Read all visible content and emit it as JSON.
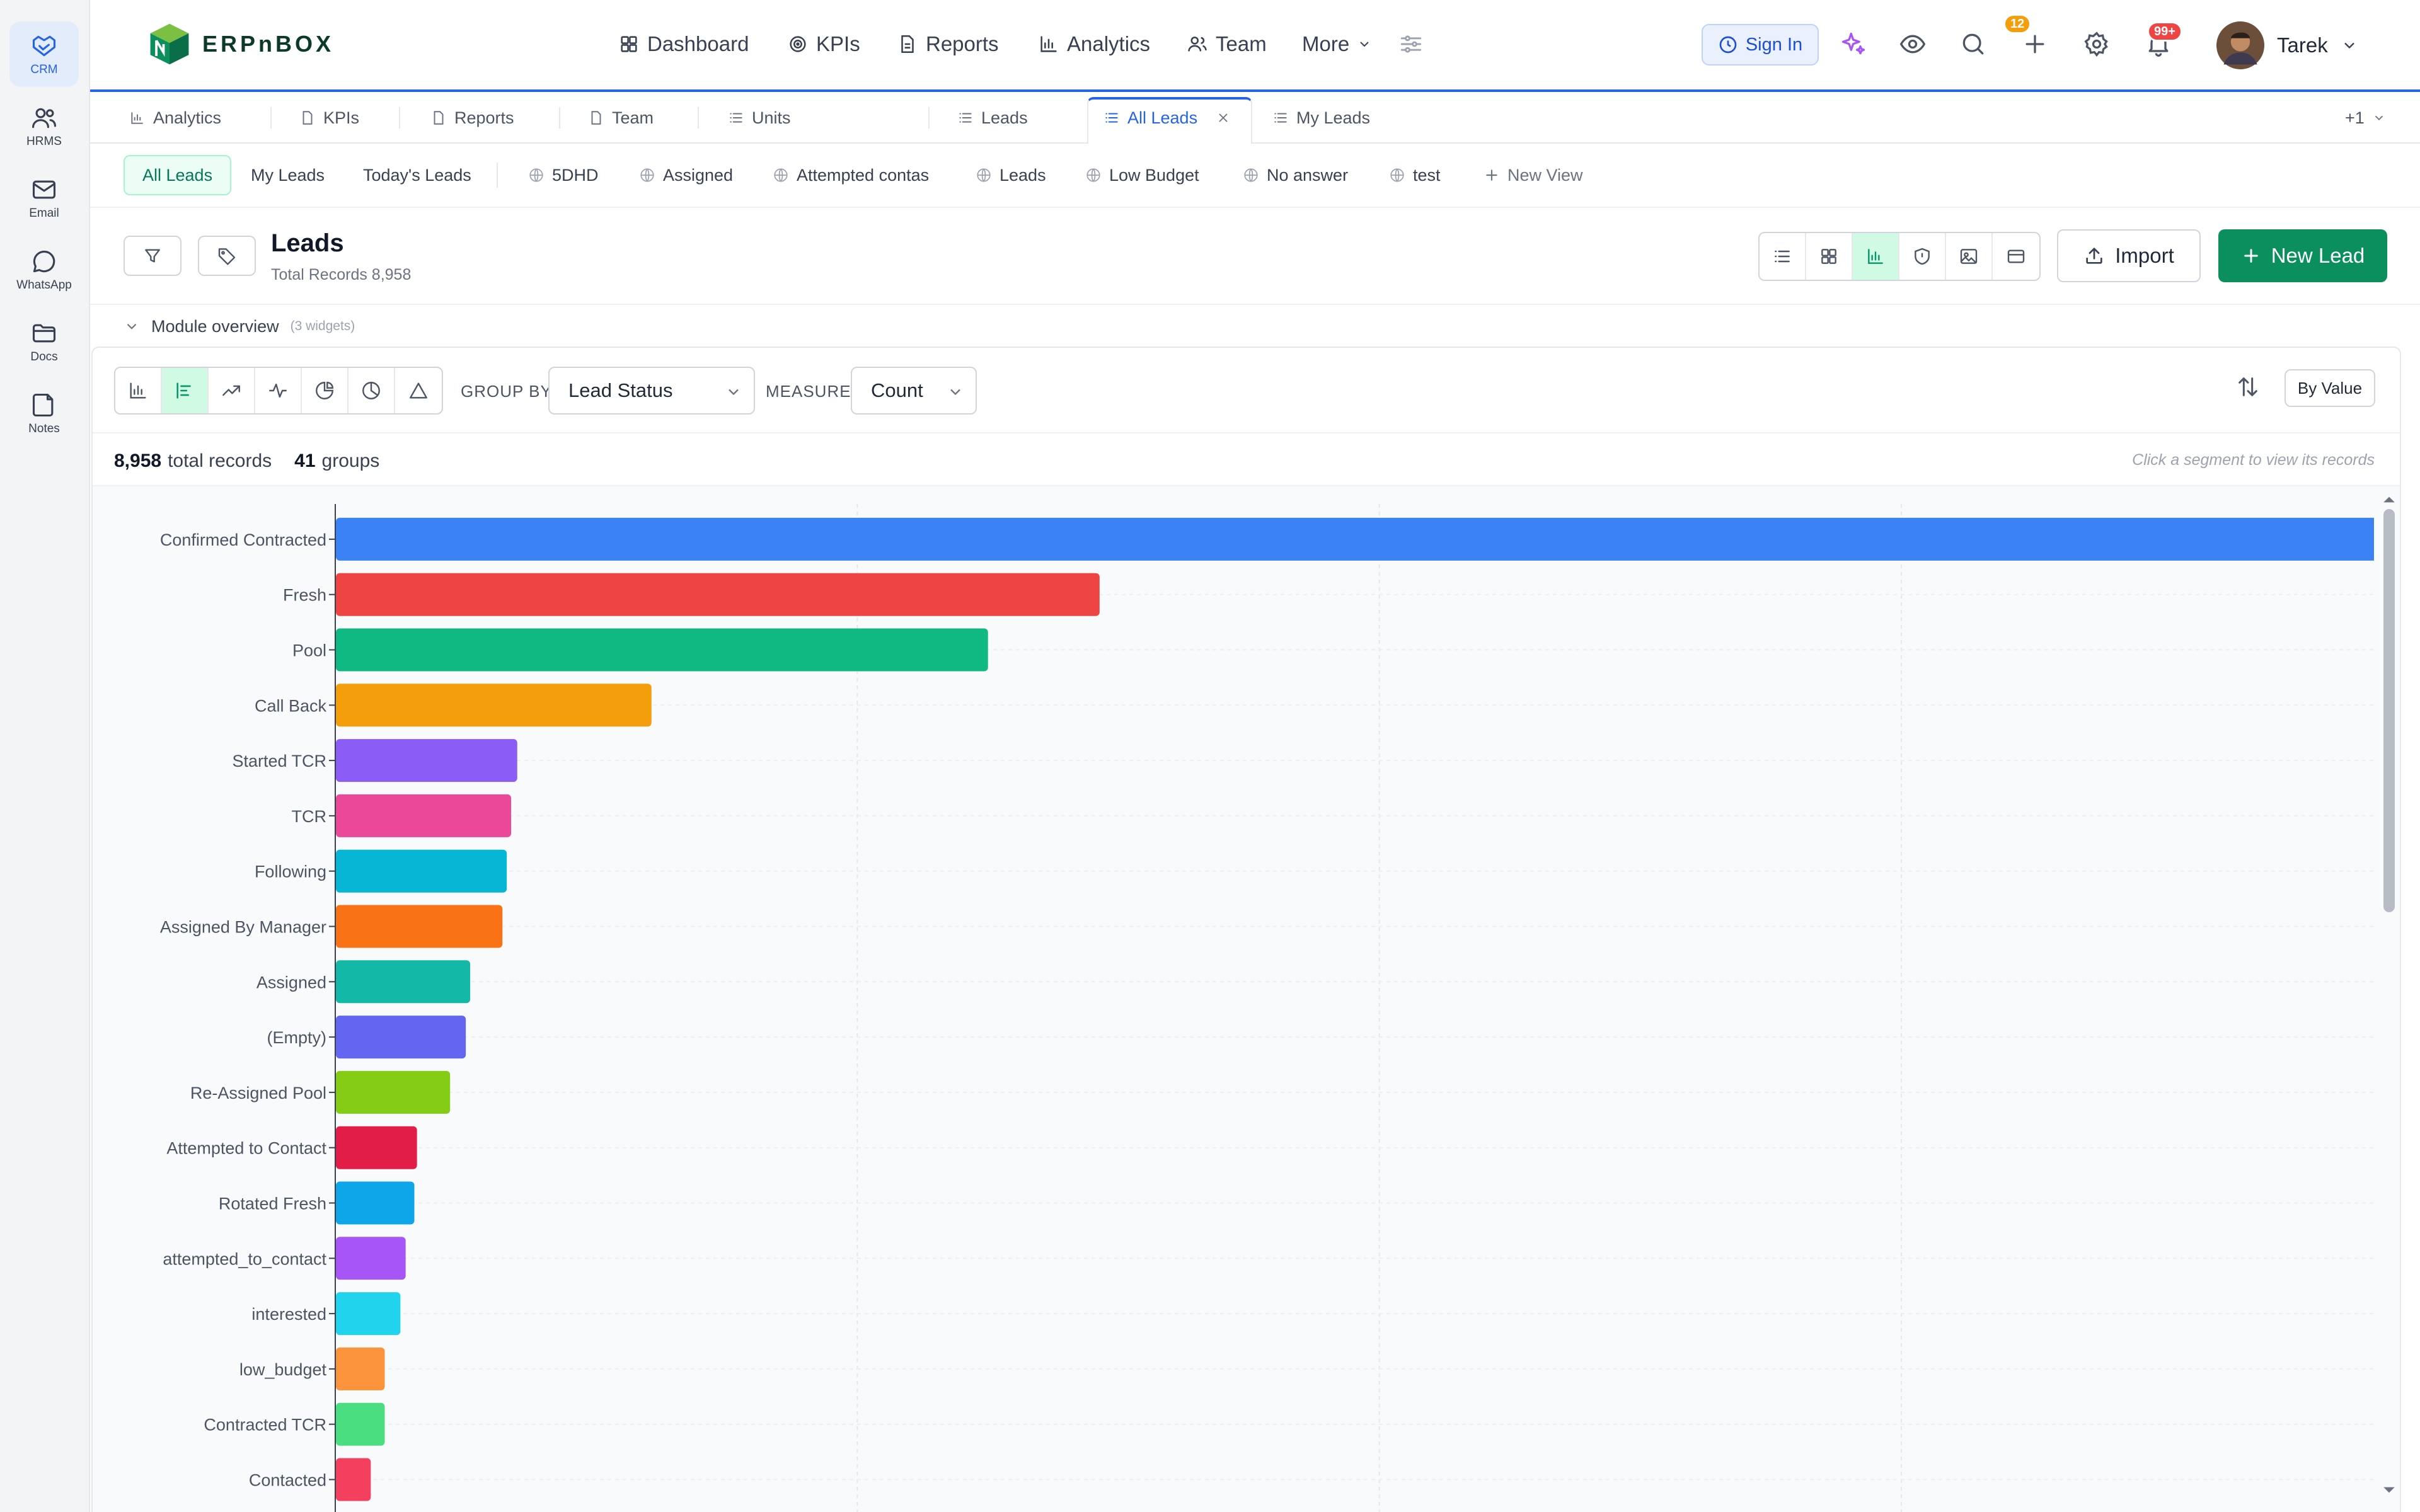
{
  "rail": {
    "items": [
      {
        "label": "CRM",
        "icon": "handshake-icon"
      },
      {
        "label": "HRMS",
        "icon": "users-icon"
      },
      {
        "label": "Email",
        "icon": "mail-icon"
      },
      {
        "label": "WhatsApp",
        "icon": "chat-bubble-icon"
      },
      {
        "label": "Docs",
        "icon": "folder-icon"
      },
      {
        "label": "Notes",
        "icon": "note-icon"
      }
    ]
  },
  "header": {
    "logo_text": "ERPnBOX",
    "nav": [
      "Dashboard",
      "KPIs",
      "Reports",
      "Analytics",
      "Team",
      "More"
    ],
    "sign_in": "Sign In",
    "watch_badge": "12",
    "notif_badge": "99+",
    "user_name": "Tarek"
  },
  "tabs": {
    "items": [
      "Analytics",
      "KPIs",
      "Reports",
      "Team",
      "Units",
      "Leads",
      "All Leads",
      "My Leads"
    ],
    "overflow": "+1"
  },
  "views": {
    "items": [
      "All Leads",
      "My Leads",
      "Today's Leads",
      "5DHD",
      "Assigned",
      "Attempted contas",
      "Leads",
      "Low Budget",
      "No answer",
      "test"
    ],
    "new_view": "New View"
  },
  "page": {
    "title": "Leads",
    "subtitle": "Total Records 8,958",
    "import_label": "Import",
    "new_lead_label": "New Lead"
  },
  "overview": {
    "label": "Module overview",
    "count": "(3 widgets)"
  },
  "chart_controls": {
    "group_by_label": "GROUP BY",
    "group_by_value": "Lead Status",
    "measure_label": "MEASURE",
    "measure_value": "Count",
    "sort_label": "By Value"
  },
  "summary": {
    "total": "8,958",
    "total_suffix": "total records",
    "groups": "41",
    "groups_suffix": "groups",
    "hint": "Click a segment to view its records"
  },
  "colors": {
    "brand_green": "#0b8f5c",
    "accent_blue": "#2563eb",
    "badge_orange": "#f59e0b",
    "badge_red": "#ef4444"
  },
  "chart_data": {
    "type": "bar",
    "orientation": "horizontal",
    "categories": [
      "Confirmed Contracted",
      "Fresh",
      "Pool",
      "Call Back",
      "Started TCR",
      "TCR",
      "Following",
      "Assigned By Manager",
      "Assigned",
      "(Empty)",
      "Re-Assigned Pool",
      "Attempted to Contact",
      "Rotated Fresh",
      "attempted_to_contact",
      "interested",
      "low_budget",
      "Contracted TCR",
      "Contacted"
    ],
    "values": [
      2394,
      876,
      748,
      362,
      208,
      201,
      196,
      191,
      154,
      149,
      131,
      93,
      90,
      80,
      74,
      56,
      56,
      40
    ],
    "colors": [
      "#3b82f6",
      "#ef4444",
      "#10b981",
      "#f59e0b",
      "#8b5cf6",
      "#ec4899",
      "#06b6d4",
      "#f97316",
      "#14b8a6",
      "#6366f1",
      "#84cc16",
      "#e11d48",
      "#0ea5e9",
      "#a855f7",
      "#22d3ee",
      "#fb923c",
      "#4ade80",
      "#f43f5e"
    ],
    "xlim": [
      0,
      2400
    ],
    "grid": true
  }
}
